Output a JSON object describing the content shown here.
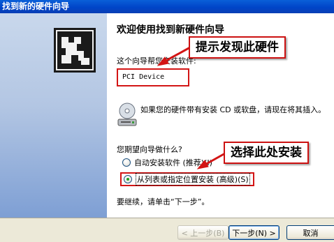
{
  "window": {
    "title": "找到新的硬件向导"
  },
  "content": {
    "heading": "欢迎使用找到新硬件向导",
    "intro": "这个向导帮您安装软件:",
    "device_name": "PCI Device",
    "cd_instructions": "如果您的硬件带有安装 CD 或软盘，请现在将其插入。",
    "question": "您期望向导做什么?",
    "options": [
      {
        "label": "自动安装软件 (推荐)(I)",
        "selected": false
      },
      {
        "label": "从列表或指定位置安装 (高级)(S)",
        "selected": true
      }
    ],
    "continue_text": "要继续，请单击“下一步”。"
  },
  "annotations": {
    "callout_1": "提示发现此硬件",
    "callout_2": "选择此处安装",
    "color": "#d31515"
  },
  "buttons": {
    "back": "< 上一步(B)",
    "next": "下一步(N) >",
    "cancel": "取消"
  }
}
